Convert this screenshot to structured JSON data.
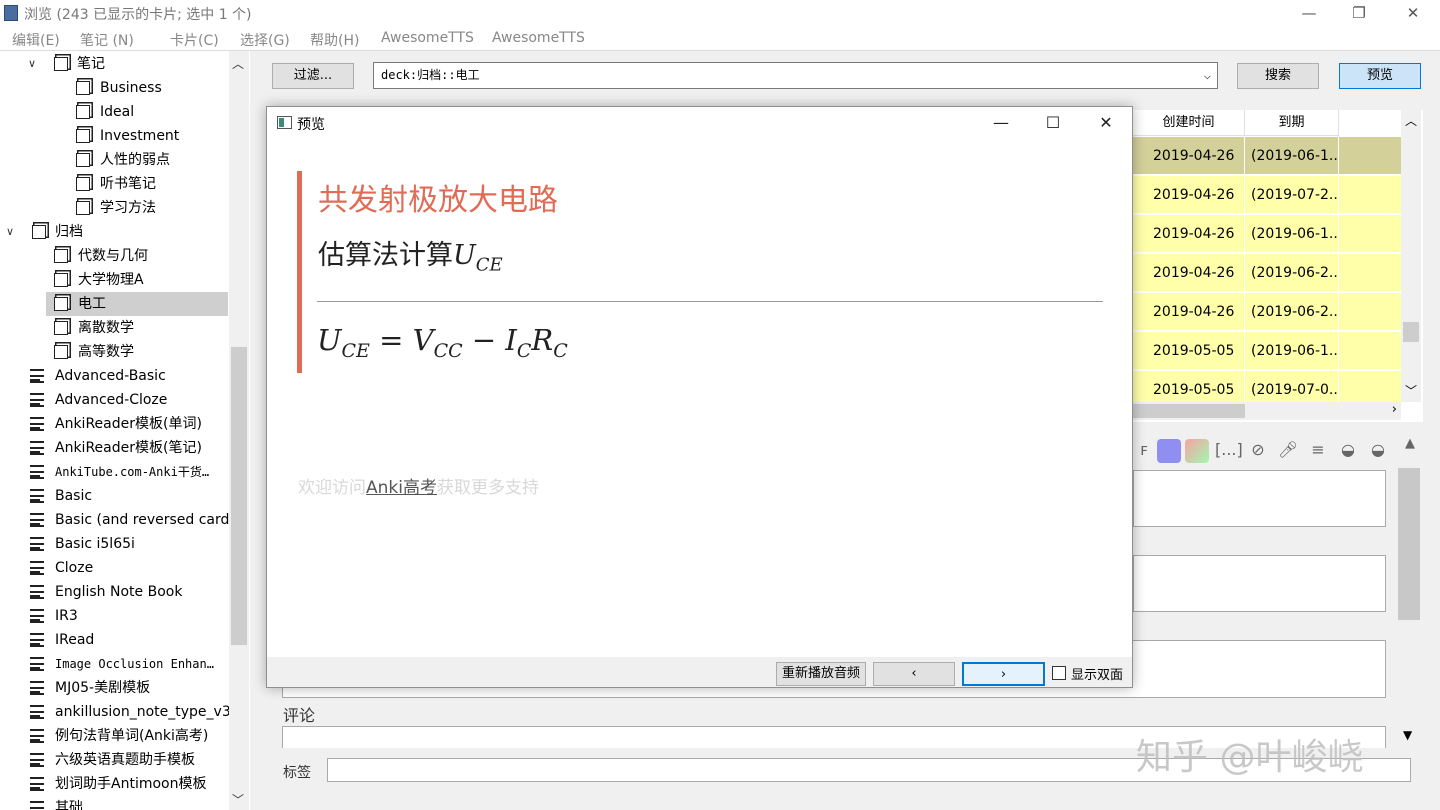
{
  "window": {
    "title": "浏览 (243 已显示的卡片; 选中 1 个)",
    "minimize": "—",
    "maximize": "❐",
    "close": "✕"
  },
  "menu": [
    "编辑(E)",
    "笔记 (N)",
    "卡片(C)",
    "选择(G)",
    "帮助(H)",
    "AwesomeTTS",
    "AwesomeTTS"
  ],
  "sidebar": {
    "items": [
      {
        "label": "笔记",
        "arrow": "∨"
      },
      {
        "label": "Business"
      },
      {
        "label": "Ideal"
      },
      {
        "label": "Investment"
      },
      {
        "label": "人性的弱点"
      },
      {
        "label": "听书笔记"
      },
      {
        "label": "学习方法"
      },
      {
        "label": "归档",
        "arrow": "∨"
      },
      {
        "label": "代数与几何"
      },
      {
        "label": "大学物理A"
      },
      {
        "label": "电工"
      },
      {
        "label": "离散数学"
      },
      {
        "label": "高等数学"
      },
      {
        "label": "Advanced-Basic"
      },
      {
        "label": "Advanced-Cloze"
      },
      {
        "label": "AnkiReader模板(单词)"
      },
      {
        "label": "AnkiReader模板(笔记)"
      },
      {
        "label": "AnkiTube.com-Anki干货…"
      },
      {
        "label": "Basic"
      },
      {
        "label": "Basic (and reversed card)"
      },
      {
        "label": "Basic i5l65i"
      },
      {
        "label": "Cloze"
      },
      {
        "label": "English Note Book"
      },
      {
        "label": "IR3"
      },
      {
        "label": "IRead"
      },
      {
        "label": "Image Occlusion Enhan…"
      },
      {
        "label": "MJ05-美剧模板"
      },
      {
        "label": "ankillusion_note_type_v3"
      },
      {
        "label": "例句法背单词(Anki高考)"
      },
      {
        "label": "六级英语真题助手模板"
      },
      {
        "label": "划词助手Antimoon模板"
      },
      {
        "label": "其础"
      }
    ]
  },
  "toolbar": {
    "filter_label": "过滤...",
    "search_value": "deck:归档::电工",
    "search_button": "搜索",
    "preview_button": "预览"
  },
  "table": {
    "headers": [
      "创建时间",
      "到期"
    ],
    "rows": [
      {
        "created": "2019-04-26",
        "due": "(2019-06-1..."
      },
      {
        "created": "2019-04-26",
        "due": "(2019-07-2..."
      },
      {
        "created": "2019-04-26",
        "due": "(2019-06-1..."
      },
      {
        "created": "2019-04-26",
        "due": "(2019-06-2..."
      },
      {
        "created": "2019-04-26",
        "due": "(2019-06-2..."
      },
      {
        "created": "2019-05-05",
        "due": "(2019-06-1..."
      },
      {
        "created": "2019-05-05",
        "due": "(2019-07-0..."
      }
    ]
  },
  "editor": {
    "comment_label": "评论",
    "tags_label": "标签"
  },
  "preview": {
    "title": "预览",
    "heading": "共发射极放大电路",
    "subheading_text": "估算法计算",
    "subheading_math": "U",
    "subheading_sub": "CE",
    "equation": {
      "u": "U",
      "u_sub": "CE",
      "eq": " = ",
      "v": "V",
      "v_sub": "CC",
      "minus": " − ",
      "i": "I",
      "i_sub": "C",
      "r": "R",
      "r_sub": "C"
    },
    "note_prefix": "欢迎访问",
    "note_link": "Anki高考",
    "note_suffix": "获取更多支持",
    "replay_button": "重新播放音频",
    "prev_button": "‹",
    "next_button": "›",
    "show_both_label": "显示双面"
  },
  "watermark": "知乎 @叶峻峣"
}
